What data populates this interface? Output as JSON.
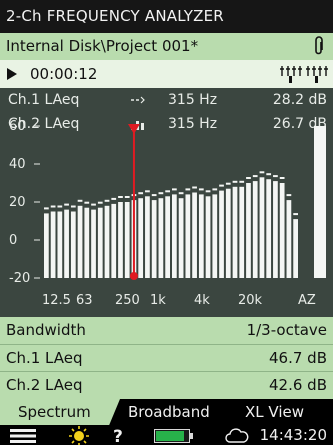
{
  "title": "2-Ch FREQUENCY ANALYZER",
  "path": "Internal Disk\\Project 001*",
  "status": {
    "elapsed": "00:00:12"
  },
  "measurements": [
    {
      "name": "Ch.1 LAeq",
      "frequency": "315 Hz",
      "value": "28.2 dB",
      "icon": "dash-line-icon"
    },
    {
      "name": "Ch.2 LAeq",
      "frequency": "315 Hz",
      "value": "26.7 dB",
      "icon": "bar-icon"
    }
  ],
  "chart_data": {
    "type": "bar",
    "ylim": [
      -20,
      60
    ],
    "yticks": [
      "60",
      "40",
      "20",
      "0",
      "-20"
    ],
    "xtick_labels": [
      "12.5",
      "63",
      "250",
      "1k",
      "4k",
      "20k",
      "AZ"
    ],
    "cursor_band": "250",
    "series": [
      {
        "values": [
          14,
          15,
          15,
          16,
          15,
          18,
          17,
          16,
          17,
          18,
          19,
          20,
          20,
          21,
          22,
          23,
          21,
          22,
          23,
          24,
          22,
          24,
          25,
          24,
          23,
          24,
          26,
          27,
          28,
          28,
          30,
          31,
          33,
          32,
          31,
          30,
          21,
          11
        ]
      }
    ]
  },
  "settings": {
    "bandwidth_label": "Bandwidth",
    "bandwidth_value": "1/3-octave",
    "ch1_label": "Ch.1 LAeq",
    "ch1_value": "46.7 dB",
    "ch2_label": "Ch.2 LAeq",
    "ch2_value": "42.6 dB"
  },
  "tabs": [
    {
      "label": "Spectrum",
      "active": true
    },
    {
      "label": "Broadband",
      "active": false
    },
    {
      "label": "XL View",
      "active": false
    }
  ],
  "bottom": {
    "clock": "14:43:20"
  },
  "colors": {
    "accent": "#b9dcae",
    "cursor": "#e01b22",
    "chart_bg": "#3b4640"
  }
}
